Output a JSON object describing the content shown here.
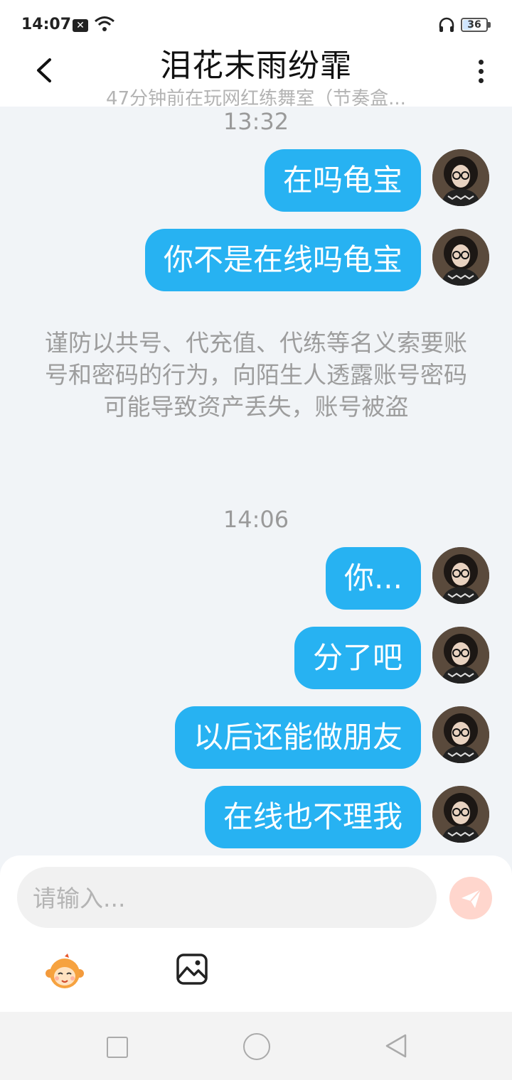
{
  "status_bar": {
    "time": "14:07",
    "notification_icon": "x-badge-icon",
    "battery": "36",
    "icons": [
      "wifi-icon",
      "headset-icon",
      "battery-icon"
    ]
  },
  "header": {
    "title": "泪花末雨纷霏",
    "subtitle": "47分钟前在玩网红练舞室（节奏盒...",
    "back_icon": "chevron-left-icon",
    "more_icon": "more-vertical-icon"
  },
  "chat": {
    "timestamp_1": "13:32",
    "messages_group_1": [
      {
        "text": "在吗龟宝"
      },
      {
        "text": "你不是在线吗龟宝"
      }
    ],
    "warning": "谨防以共号、代充值、代练等名义索要账号和密码的行为，向陌生人透露账号密码可能导致资产丢失，账号被盗",
    "timestamp_2": "14:06",
    "messages_group_2": [
      {
        "text": "你..."
      },
      {
        "text": "分了吧"
      },
      {
        "text": "以后还能做朋友"
      },
      {
        "text": "在线也不理我"
      }
    ]
  },
  "input": {
    "placeholder": "请输入...",
    "value": "",
    "send_icon": "paper-plane-icon",
    "toolbar": [
      "emoji-icon",
      "image-icon"
    ]
  },
  "colors": {
    "bubble": "#27b2f2",
    "background": "#f1f4f7",
    "send_button": "#ffd6cd"
  }
}
